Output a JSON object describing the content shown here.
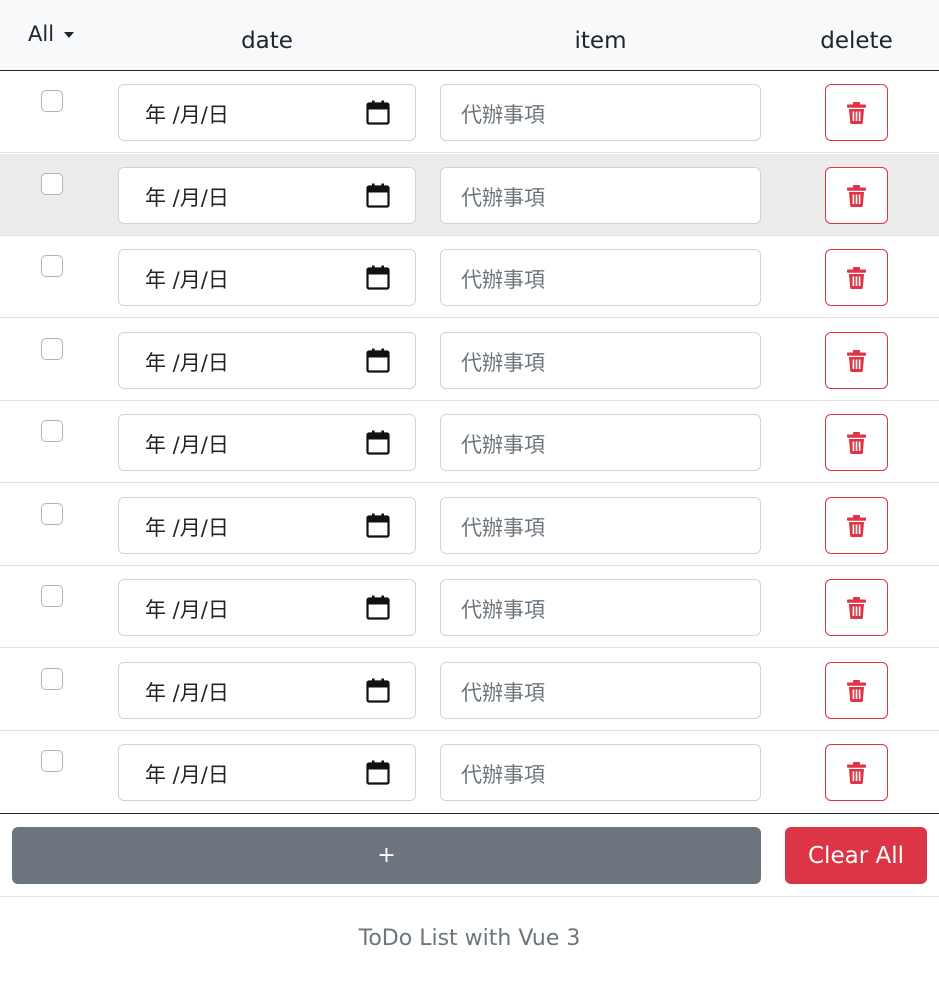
{
  "filter": {
    "label": "All"
  },
  "columns": {
    "date": "date",
    "item": "item",
    "delete": "delete"
  },
  "rows": [
    {
      "checked": false,
      "date_text": "年 /月/日",
      "item_placeholder": "代辦事項"
    },
    {
      "checked": false,
      "date_text": "年 /月/日",
      "item_placeholder": "代辦事項"
    },
    {
      "checked": false,
      "date_text": "年 /月/日",
      "item_placeholder": "代辦事項"
    },
    {
      "checked": false,
      "date_text": "年 /月/日",
      "item_placeholder": "代辦事項"
    },
    {
      "checked": false,
      "date_text": "年 /月/日",
      "item_placeholder": "代辦事項"
    },
    {
      "checked": false,
      "date_text": "年 /月/日",
      "item_placeholder": "代辦事項"
    },
    {
      "checked": false,
      "date_text": "年 /月/日",
      "item_placeholder": "代辦事項"
    },
    {
      "checked": false,
      "date_text": "年 /月/日",
      "item_placeholder": "代辦事項"
    },
    {
      "checked": false,
      "date_text": "年 /月/日",
      "item_placeholder": "代辦事項"
    }
  ],
  "icons": {
    "date": "calendar-icon",
    "delete": "trash-icon",
    "filter": "caret-down-icon"
  },
  "actions": {
    "add_label": "+",
    "clear_label": "Clear All"
  },
  "footer": {
    "text": "ToDo List with Vue 3"
  },
  "colors": {
    "danger": "#dc3545",
    "secondary": "#6c757d",
    "header_bg": "#f8f9fa",
    "stripe_bg": "#ececec"
  }
}
